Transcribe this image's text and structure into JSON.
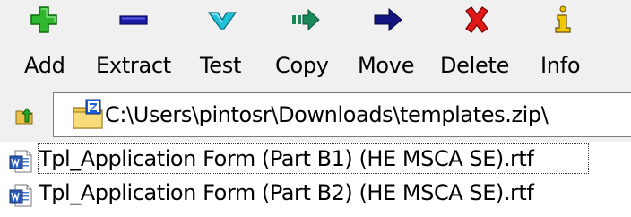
{
  "toolbar": {
    "buttons": [
      {
        "id": "add",
        "label": "Add",
        "icon": "add-plus-icon",
        "color": "#2fb82f"
      },
      {
        "id": "extract",
        "label": "Extract",
        "icon": "extract-minus-icon",
        "color": "#1a1aa8"
      },
      {
        "id": "test",
        "label": "Test",
        "icon": "test-check-icon",
        "color": "#20c0d8"
      },
      {
        "id": "copy",
        "label": "Copy",
        "icon": "copy-arrow-icon",
        "color": "#1a8a5a"
      },
      {
        "id": "move",
        "label": "Move",
        "icon": "move-arrow-icon",
        "color": "#141480"
      },
      {
        "id": "delete",
        "label": "Delete",
        "icon": "delete-x-icon",
        "color": "#e01818"
      },
      {
        "id": "info",
        "label": "Info",
        "icon": "info-i-icon",
        "color": "#c8a000"
      }
    ]
  },
  "address": {
    "up_icon": "folder-up-icon",
    "archive_icon": "zip-archive-icon",
    "path": "C:\\Users\\pintosr\\Downloads\\templates.zip\\"
  },
  "files": [
    {
      "name": "Tpl_Application Form (Part B1) (HE MSCA SE).rtf",
      "icon": "word-document-icon",
      "focused": true
    },
    {
      "name": "Tpl_Application Form (Part B2) (HE MSCA SE).rtf",
      "icon": "word-document-icon",
      "focused": false
    }
  ]
}
